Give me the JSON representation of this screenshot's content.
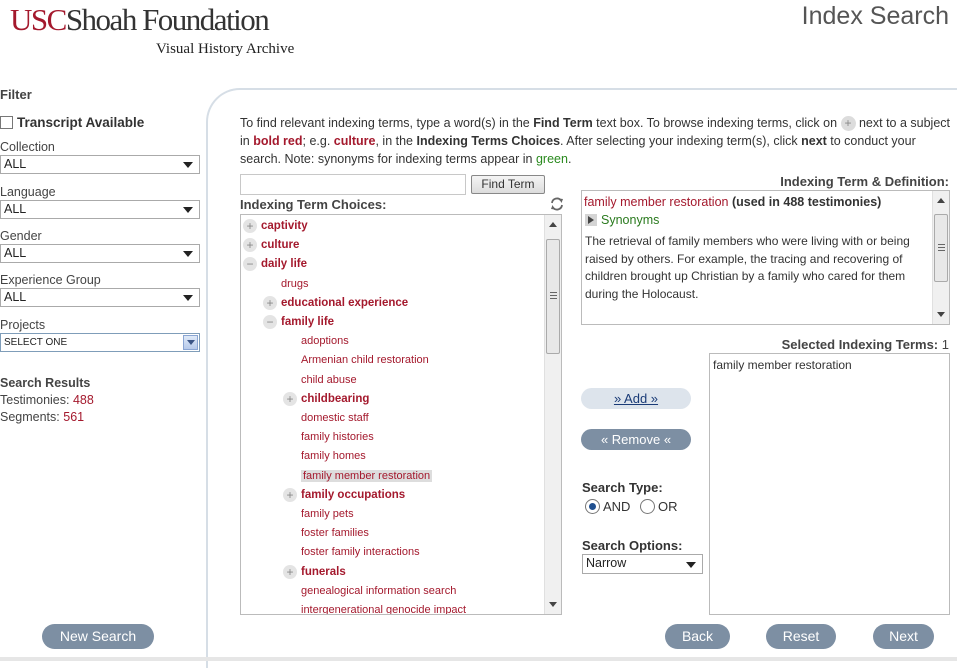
{
  "header": {
    "logo_usc": "USC",
    "logo_shoah": "Shoah Foundation",
    "logo_sub": "Visual History Archive",
    "page_title": "Index Search"
  },
  "sidebar": {
    "filter_title": "Filter",
    "transcript_label": "Transcript Available",
    "filters": [
      {
        "label": "Collection",
        "value": "ALL"
      },
      {
        "label": "Language",
        "value": "ALL"
      },
      {
        "label": "Gender",
        "value": "ALL"
      },
      {
        "label": "Experience Group",
        "value": "ALL"
      },
      {
        "label": "Projects",
        "value": "SELECT ONE"
      }
    ],
    "results_title": "Search Results",
    "testimonies_label": "Testimonies:",
    "testimonies_value": "488",
    "segments_label": "Segments:",
    "segments_value": "561"
  },
  "intro": {
    "t1": "To find relevant indexing terms, type a word(s) in the ",
    "b1": "Find Term",
    "t2": " text box. To browse indexing terms, click on ",
    "t3": " next to a subject in ",
    "red1": "bold red",
    "t4": "; e.g. ",
    "red2": "culture",
    "t5": ", in the ",
    "b2": "Indexing Terms Choices",
    "t6": ". After selecting your indexing term(s), click ",
    "b3": "next",
    "t7": " to conduct your search. Note: synonyms for indexing terms appear in ",
    "green": "green",
    "t8": "."
  },
  "find": {
    "input_value": "",
    "button_label": "Find Term"
  },
  "choices": {
    "label": "Indexing Term Choices:",
    "items": [
      {
        "label": "captivity",
        "kind": "cat",
        "toggle": "+",
        "depth": 0
      },
      {
        "label": "culture",
        "kind": "cat",
        "toggle": "+",
        "depth": 0
      },
      {
        "label": "daily life",
        "kind": "cat",
        "toggle": "−",
        "depth": 0
      },
      {
        "label": "drugs",
        "kind": "leaf",
        "toggle": "",
        "depth": 1
      },
      {
        "label": "educational experience",
        "kind": "cat",
        "toggle": "+",
        "depth": 1
      },
      {
        "label": "family life",
        "kind": "cat",
        "toggle": "−",
        "depth": 1
      },
      {
        "label": "adoptions",
        "kind": "leaf",
        "toggle": "",
        "depth": 2
      },
      {
        "label": "Armenian child restoration",
        "kind": "leaf",
        "toggle": "",
        "depth": 2
      },
      {
        "label": "child abuse",
        "kind": "leaf",
        "toggle": "",
        "depth": 2
      },
      {
        "label": "childbearing",
        "kind": "cat",
        "toggle": "+",
        "depth": 2
      },
      {
        "label": "domestic staff",
        "kind": "leaf",
        "toggle": "",
        "depth": 2
      },
      {
        "label": "family histories",
        "kind": "leaf",
        "toggle": "",
        "depth": 2
      },
      {
        "label": "family homes",
        "kind": "leaf",
        "toggle": "",
        "depth": 2
      },
      {
        "label": "family member restoration",
        "kind": "leaf",
        "toggle": "",
        "depth": 2,
        "selected": true
      },
      {
        "label": "family occupations",
        "kind": "cat",
        "toggle": "+",
        "depth": 2
      },
      {
        "label": "family pets",
        "kind": "leaf",
        "toggle": "",
        "depth": 2
      },
      {
        "label": "foster families",
        "kind": "leaf",
        "toggle": "",
        "depth": 2
      },
      {
        "label": "foster family interactions",
        "kind": "leaf",
        "toggle": "",
        "depth": 2
      },
      {
        "label": "funerals",
        "kind": "cat",
        "toggle": "+",
        "depth": 2
      },
      {
        "label": "genealogical information search",
        "kind": "leaf",
        "toggle": "",
        "depth": 2
      },
      {
        "label": "intergenerational genocide impact",
        "kind": "leaf",
        "toggle": "",
        "depth": 2
      }
    ]
  },
  "definition": {
    "label": "Indexing Term & Definition:",
    "term": "family member restoration",
    "count": "(used in 488 testimonies)",
    "synonyms_label": "Synonyms",
    "text": "The retrieval of family members who were living with or being raised by others. For example, the tracing and recovering of children brought up Christian by a family who cared for them during the Holocaust."
  },
  "selected": {
    "label": "Selected Indexing Terms:",
    "count": "1",
    "items": [
      "family member restoration"
    ]
  },
  "actions": {
    "add_label": "» Add »",
    "remove_label": "« Remove «"
  },
  "search_type": {
    "label": "Search Type:",
    "and_label": "AND",
    "or_label": "OR",
    "selected": "AND"
  },
  "search_options": {
    "label": "Search Options:",
    "value": "Narrow"
  },
  "nav": {
    "new_search": "New Search",
    "back": "Back",
    "reset": "Reset",
    "next": "Next"
  },
  "colors": {
    "brand_red": "#a4192d",
    "synonym_green": "#2a8a1e",
    "button_slate": "#7d8fa3"
  }
}
